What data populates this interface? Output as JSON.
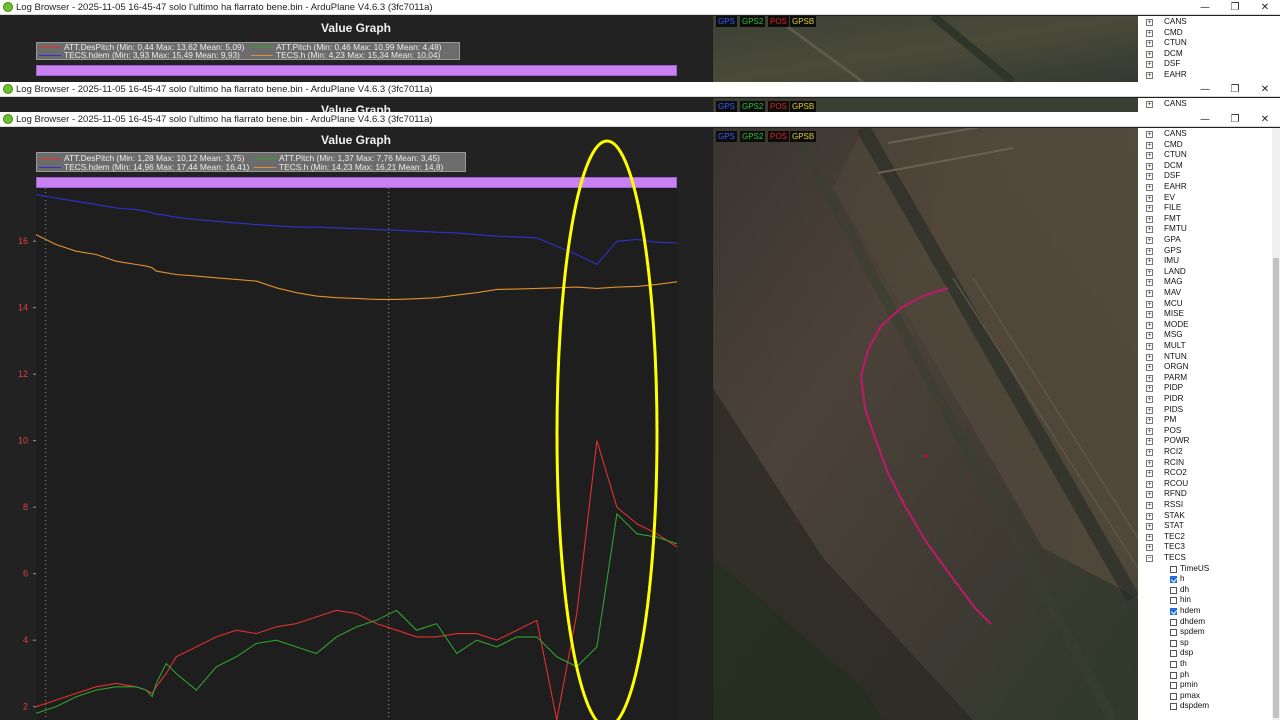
{
  "windows": {
    "top": {
      "title": "Log Browser - 2025-11-05 16-45-47 solo l'ultimo ha flarrato bene.bin - ArduPlane V4.6.3 (3fc7011a)",
      "graph_title": "Value Graph",
      "legend": [
        {
          "text": "ATT.DesPitch  (Min: 0,44 Max: 13,62 Mean: 5,09)",
          "color": "#e03030"
        },
        {
          "text": "ATT.Pitch  (Min: 0,46 Max: 10,99 Mean: 4,48)",
          "color": "#30a030"
        },
        {
          "text": "TECS.hdem  (Min: 3,93 Max: 15,49 Mean: 9,93)",
          "color": "#3030d0"
        },
        {
          "text": "TECS.h  (Min: 4,23 Max: 15,34 Mean: 10,04)",
          "color": "#e09030"
        }
      ],
      "gps_tags": [
        "GPS",
        "GPS2",
        "POS",
        "GPSB"
      ],
      "tree_items": [
        "CANS",
        "CMD",
        "CTUN",
        "DCM",
        "DSF",
        "EAHR"
      ]
    },
    "middle": {
      "title": "Log Browser - 2025-11-05 16-45-47 solo l'ultimo ha flarrato bene.bin - ArduPlane V4.6.3 (3fc7011a)",
      "graph_title": "Value Graph",
      "gps_tags": [
        "GPS",
        "GPS2",
        "POS",
        "GPSB"
      ],
      "tree_items": [
        "CANS"
      ]
    },
    "main": {
      "title": "Log Browser - 2025-11-05 16-45-47 solo l'ultimo ha flarrato bene.bin - ArduPlane V4.6.3 (3fc7011a)",
      "graph_title": "Value Graph",
      "legend": [
        {
          "text": "ATT.DesPitch  (Min: 1,28 Max: 10,12 Mean: 3,75)",
          "color": "#e03030"
        },
        {
          "text": "ATT.Pitch  (Min: 1,37 Max: 7,76 Mean: 3,45)",
          "color": "#30a030"
        },
        {
          "text": "TECS.hdem  (Min: 14,96 Max: 17,44 Mean: 16,41)",
          "color": "#3030d0"
        },
        {
          "text": "TECS.h  (Min: 14,23 Max: 16,21 Mean: 14,8)",
          "color": "#e09030"
        }
      ],
      "gps_tags": [
        "GPS",
        "GPS2",
        "POS",
        "GPSB"
      ],
      "tree_items": [
        "CANS",
        "CMD",
        "CTUN",
        "DCM",
        "DSF",
        "EAHR",
        "EV",
        "FILE",
        "FMT",
        "FMTU",
        "GPA",
        "GPS",
        "IMU",
        "LAND",
        "MAG",
        "MAV",
        "MCU",
        "MISE",
        "MODE",
        "MSG",
        "MULT",
        "NTUN",
        "ORGN",
        "PARM",
        "PIDP",
        "PIDR",
        "PIDS",
        "PM",
        "POS",
        "POWR",
        "RCI2",
        "RCIN",
        "RCO2",
        "RCOU",
        "RFND",
        "RSSI",
        "STAK",
        "STAT",
        "TEC2",
        "TEC3",
        "TECS"
      ],
      "tecs_fields": [
        {
          "name": "TimeUS",
          "checked": false
        },
        {
          "name": "h",
          "checked": true
        },
        {
          "name": "dh",
          "checked": false
        },
        {
          "name": "hin",
          "checked": false
        },
        {
          "name": "hdem",
          "checked": true
        },
        {
          "name": "dhdem",
          "checked": false
        },
        {
          "name": "spdem",
          "checked": false
        },
        {
          "name": "sp",
          "checked": false
        },
        {
          "name": "dsp",
          "checked": false
        },
        {
          "name": "th",
          "checked": false
        },
        {
          "name": "ph",
          "checked": false
        },
        {
          "name": "pmin",
          "checked": false
        },
        {
          "name": "pmax",
          "checked": false
        },
        {
          "name": "dspdem",
          "checked": false
        }
      ]
    }
  },
  "window_controls": [
    "—",
    "❐",
    "✕"
  ],
  "colors": {
    "graph_bg": "#222222",
    "zoom_bar": "#c882f2",
    "highlight_ellipse": "#ffff00",
    "flight_track": "#c0186a"
  },
  "chart_data": {
    "type": "line",
    "title": "Value Graph",
    "ylim": [
      1.6,
      17.6
    ],
    "y_ticks": [
      "16",
      "14",
      "12",
      "10",
      "8",
      "6",
      "4",
      "2"
    ],
    "x": [
      0,
      10,
      20,
      30,
      40,
      50,
      55,
      58,
      60,
      65,
      70,
      80,
      90,
      100,
      110,
      120,
      130,
      140,
      150,
      160,
      170,
      180,
      190,
      200,
      210,
      220,
      230,
      240,
      250,
      260,
      270,
      280,
      290,
      300,
      310,
      320
    ],
    "series": [
      {
        "name": "ATT.DesPitch",
        "color": "#e03030",
        "values": [
          2.0,
          2.2,
          2.4,
          2.6,
          2.7,
          2.6,
          2.5,
          2.4,
          2.6,
          3.0,
          3.5,
          3.8,
          4.1,
          4.3,
          4.2,
          4.4,
          4.5,
          4.7,
          4.9,
          4.8,
          4.5,
          4.3,
          4.1,
          4.1,
          4.2,
          4.2,
          4.0,
          4.3,
          4.6,
          1.6,
          4.8,
          10.0,
          8.0,
          7.5,
          7.2,
          6.8
        ]
      },
      {
        "name": "ATT.Pitch",
        "color": "#30a030",
        "values": [
          1.8,
          2.0,
          2.3,
          2.5,
          2.6,
          2.6,
          2.5,
          2.3,
          2.7,
          3.3,
          3.0,
          2.5,
          3.2,
          3.5,
          3.9,
          4.0,
          3.8,
          3.6,
          4.1,
          4.4,
          4.6,
          4.9,
          4.3,
          4.5,
          3.6,
          4.0,
          3.8,
          4.1,
          4.1,
          3.5,
          3.2,
          3.8,
          7.8,
          7.2,
          7.1,
          6.9
        ]
      },
      {
        "name": "TECS.hdem",
        "color": "#3030d0",
        "values": [
          17.4,
          17.3,
          17.2,
          17.1,
          17.0,
          16.95,
          16.9,
          16.85,
          16.82,
          16.78,
          16.72,
          16.65,
          16.6,
          16.55,
          16.5,
          16.46,
          16.43,
          16.42,
          16.4,
          16.38,
          16.35,
          16.33,
          16.3,
          16.27,
          16.25,
          16.2,
          16.15,
          16.13,
          16.1,
          15.85,
          15.6,
          15.3,
          16.0,
          16.05,
          15.97,
          15.95
        ]
      },
      {
        "name": "TECS.h",
        "color": "#e09030",
        "values": [
          16.2,
          15.9,
          15.7,
          15.6,
          15.4,
          15.3,
          15.25,
          15.2,
          15.1,
          15.05,
          15.0,
          14.95,
          14.9,
          14.85,
          14.8,
          14.6,
          14.45,
          14.35,
          14.3,
          14.28,
          14.25,
          14.25,
          14.27,
          14.3,
          14.38,
          14.45,
          14.55,
          14.56,
          14.58,
          14.6,
          14.62,
          14.58,
          14.62,
          14.64,
          14.7,
          14.78
        ]
      }
    ]
  },
  "map": {
    "track": [
      [
        235,
        160
      ],
      [
        210,
        168
      ],
      [
        188,
        180
      ],
      [
        168,
        198
      ],
      [
        155,
        222
      ],
      [
        148,
        248
      ],
      [
        152,
        280
      ],
      [
        162,
        310
      ],
      [
        175,
        345
      ],
      [
        192,
        378
      ],
      [
        212,
        412
      ],
      [
        238,
        448
      ],
      [
        262,
        480
      ],
      [
        278,
        496
      ]
    ]
  }
}
